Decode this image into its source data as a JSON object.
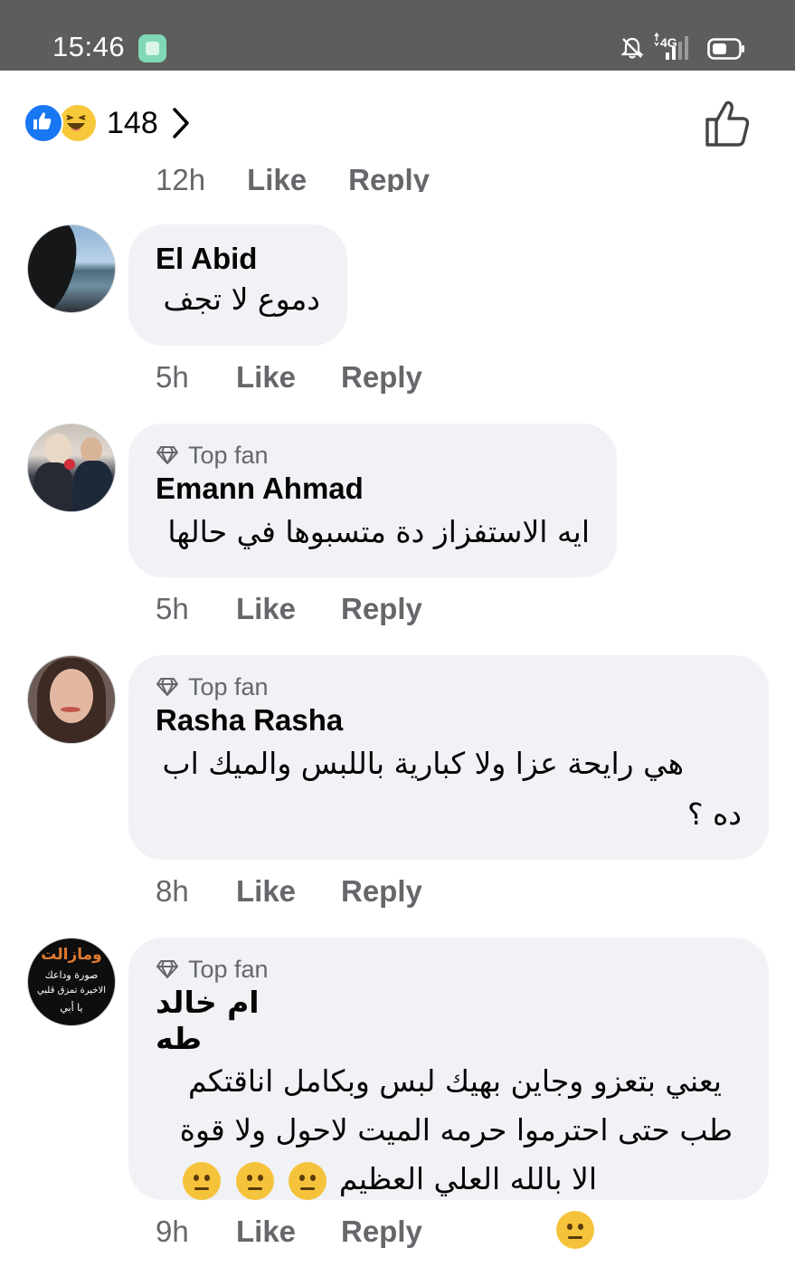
{
  "status_bar": {
    "time": "15:46",
    "network": "4G"
  },
  "header": {
    "reaction_count": "148"
  },
  "cutoff_row": {
    "time": "12h",
    "like": "Like",
    "reply": "Reply"
  },
  "comments": [
    {
      "badge": "",
      "name": "El Abid",
      "lines": [
        "دموع لا تجف"
      ],
      "time": "5h",
      "like": "Like",
      "reply": "Reply"
    },
    {
      "badge": "Top fan",
      "name": "Emann Ahmad",
      "lines": [
        "ايه الاستفزاز دة متسبوها  في حالها"
      ],
      "time": "5h",
      "like": "Like",
      "reply": "Reply"
    },
    {
      "badge": "Top fan",
      "name": "Rasha Rasha",
      "lines": [
        "هي رايحة عزا ولا كبارية باللبس والميك اب",
        "ده ؟"
      ],
      "time": "8h",
      "like": "Like",
      "reply": "Reply"
    },
    {
      "badge": "Top fan",
      "name": "ام خالد طه",
      "lines": [
        "يعني بتعزو وجاين بهيك لبس  وبكامل اناقتكم",
        "طب حتى احترموا حرمه الميت لاحول ولا قوة",
        "الا بالله العلي العظيم"
      ],
      "time": "9h",
      "like": "Like",
      "reply": "Reply"
    }
  ],
  "avatar_4_text": {
    "line1": "ومازالت",
    "line2": "صورة وداعك",
    "line3": "الاخيرة تمزق قلبي",
    "line4": "يا أبي"
  },
  "colors": {
    "status_bar": "#5d5d5d",
    "bubble": "#f0f2f5",
    "secondary_text": "#65676b",
    "like_blue": "#1877f2",
    "haha_yellow": "#f7c83a"
  },
  "icons": [
    "app-notification-icon",
    "bell-off-icon",
    "signal-4g-icon",
    "battery-icon",
    "like-reaction-icon",
    "haha-reaction-icon",
    "chevron-right-icon",
    "thumbs-up-icon",
    "diamond-icon",
    "frown-emoji-icon"
  ]
}
